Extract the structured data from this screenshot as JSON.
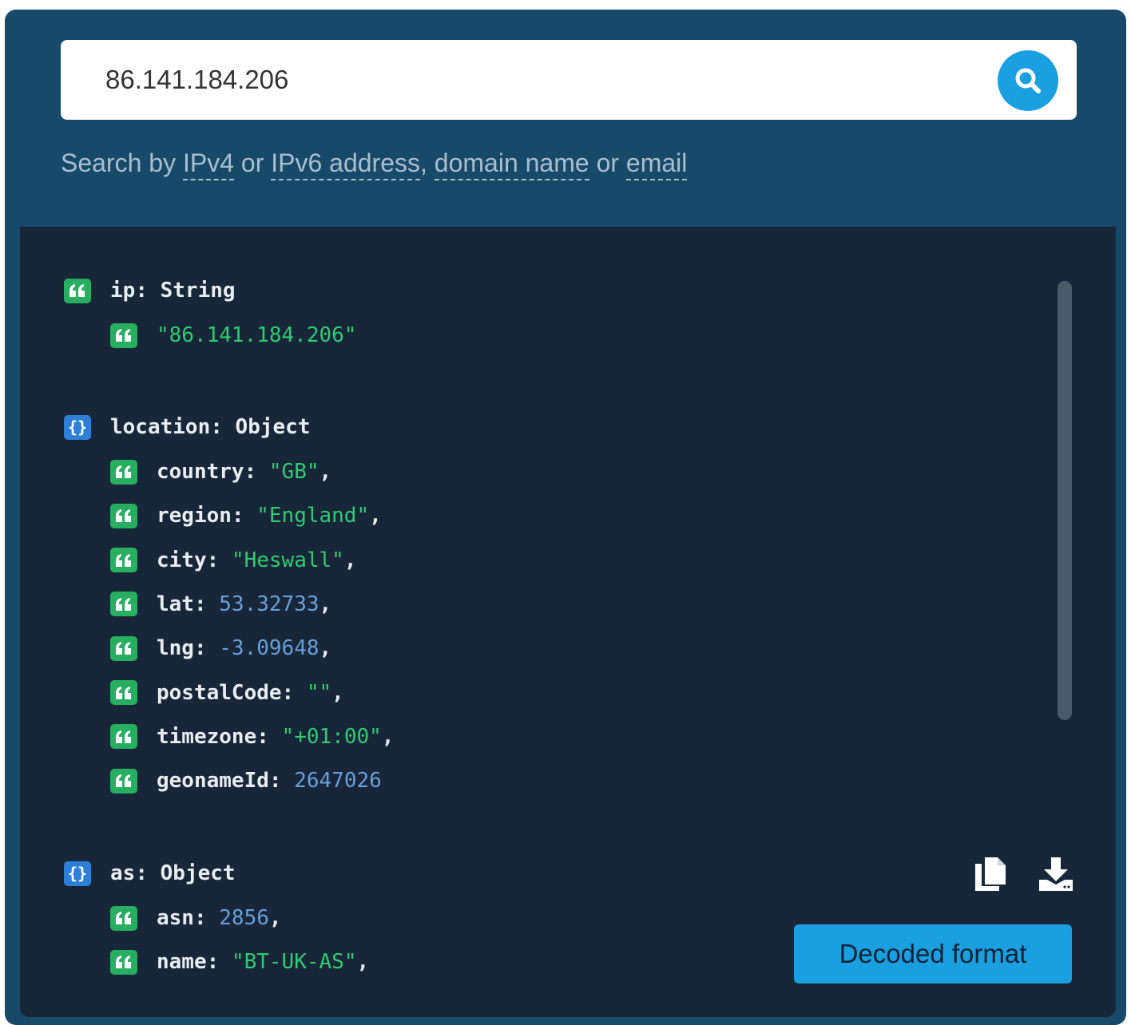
{
  "search": {
    "value": "86.141.184.206",
    "hint": {
      "prefix": "Search by ",
      "ipv4": "IPv4",
      "or1": " or ",
      "ipv6": "IPv6 address",
      "comma": ", ",
      "domain": "domain name",
      "or2": " or ",
      "email": "email"
    }
  },
  "result": {
    "ip": {
      "key": "ip",
      "type": "String",
      "value": "\"86.141.184.206\""
    },
    "location": {
      "key": "location",
      "type": "Object",
      "fields": [
        {
          "key": "country",
          "value": "\"GB\"",
          "sep": ","
        },
        {
          "key": "region",
          "value": "\"England\"",
          "sep": ","
        },
        {
          "key": "city",
          "value": "\"Heswall\"",
          "sep": ","
        },
        {
          "key": "lat",
          "value": "53.32733",
          "sep": ","
        },
        {
          "key": "lng",
          "value": "-3.09648",
          "sep": ","
        },
        {
          "key": "postalCode",
          "value": "\"\"",
          "sep": ","
        },
        {
          "key": "timezone",
          "value": "\"+01:00\"",
          "sep": ","
        },
        {
          "key": "geonameId",
          "value": "2647026",
          "sep": ""
        }
      ]
    },
    "as": {
      "key": "as",
      "type": "Object",
      "fields": [
        {
          "key": "asn",
          "value": "2856",
          "sep": ","
        },
        {
          "key": "name",
          "value": "\"BT-UK-AS\"",
          "sep": ","
        }
      ]
    }
  },
  "actions": {
    "decode_label": "Decoded format",
    "copy_icon": "copy-icon",
    "download_icon": "download-icon"
  },
  "colors": {
    "header_bg": "#174a68",
    "panel_bg": "#172638",
    "accent": "#1a9fe0",
    "string_green": "#2ecc71",
    "number_blue": "#6a9fd8",
    "string_icon": "#27ae60",
    "object_icon": "#2e7fd8"
  }
}
